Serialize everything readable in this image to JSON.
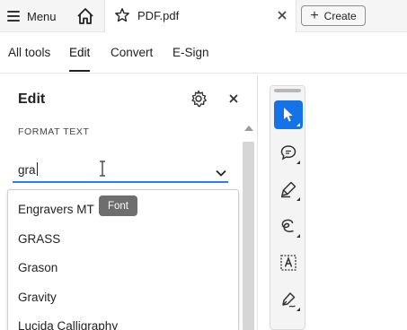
{
  "titlebar": {
    "menu_label": "Menu",
    "home_icon": "home-icon",
    "tab": {
      "title": "PDF.pdf",
      "star_icon": "star-icon",
      "close_icon": "close-icon"
    },
    "create_label": "Create"
  },
  "toolbar": {
    "tabs": [
      {
        "label": "All tools"
      },
      {
        "label": "Edit",
        "active": true
      },
      {
        "label": "Convert"
      },
      {
        "label": "E-Sign"
      }
    ]
  },
  "panel": {
    "title": "Edit",
    "section_label": "FORMAT TEXT",
    "font_input": {
      "value": "gra"
    },
    "font_options": [
      "Engravers MT",
      "GRASS",
      "Grason",
      "Gravity",
      "Lucida Calligraphy"
    ],
    "tooltip": "Font"
  },
  "rail": {
    "tools": [
      {
        "name": "select-tool-icon",
        "selected": true
      },
      {
        "name": "comment-icon"
      },
      {
        "name": "highlight-pen-icon"
      },
      {
        "name": "freehand-draw-icon"
      },
      {
        "name": "text-box-icon"
      },
      {
        "name": "sign-pen-icon"
      }
    ]
  },
  "colors": {
    "accent": "#1473e6",
    "input_focus": "#2680eb",
    "tooltip_bg": "#6e6e6e"
  }
}
